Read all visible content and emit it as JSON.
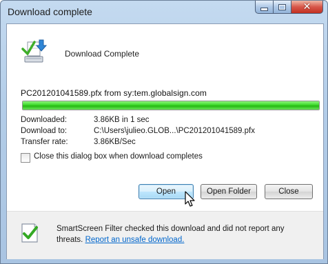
{
  "window": {
    "title": "Download complete"
  },
  "header": {
    "headline": "Download Complete"
  },
  "download": {
    "filename_line": "PC201201041589.pfx from sy:tem.globalsign.com",
    "progress": 1.0,
    "rows": [
      {
        "label": "Downloaded:",
        "value": "3.86KB in 1 sec"
      },
      {
        "label": "Download to:",
        "value": "C:\\Users\\julieo.GLOB...\\PC201201041589.pfx"
      },
      {
        "label": "Transfer rate:",
        "value": "3.86KB/Sec"
      }
    ]
  },
  "options": {
    "close_checkbox_label": "Close this dialog box when download completes",
    "close_checkbox_checked": false
  },
  "buttons": {
    "open": "Open",
    "open_folder": "Open Folder",
    "close": "Close"
  },
  "footer": {
    "smartscreen_text": "SmartScreen Filter checked this download and did not report any threats.",
    "report_link": "Report an unsafe download."
  },
  "icons": {
    "download": "download-computer-icon",
    "shield": "smartscreen-shield-icon",
    "cursor": "mouse-pointer-icon"
  },
  "colors": {
    "progress_green": "#2fcf1c",
    "link_blue": "#0066cc",
    "close_red": "#c9362a"
  }
}
